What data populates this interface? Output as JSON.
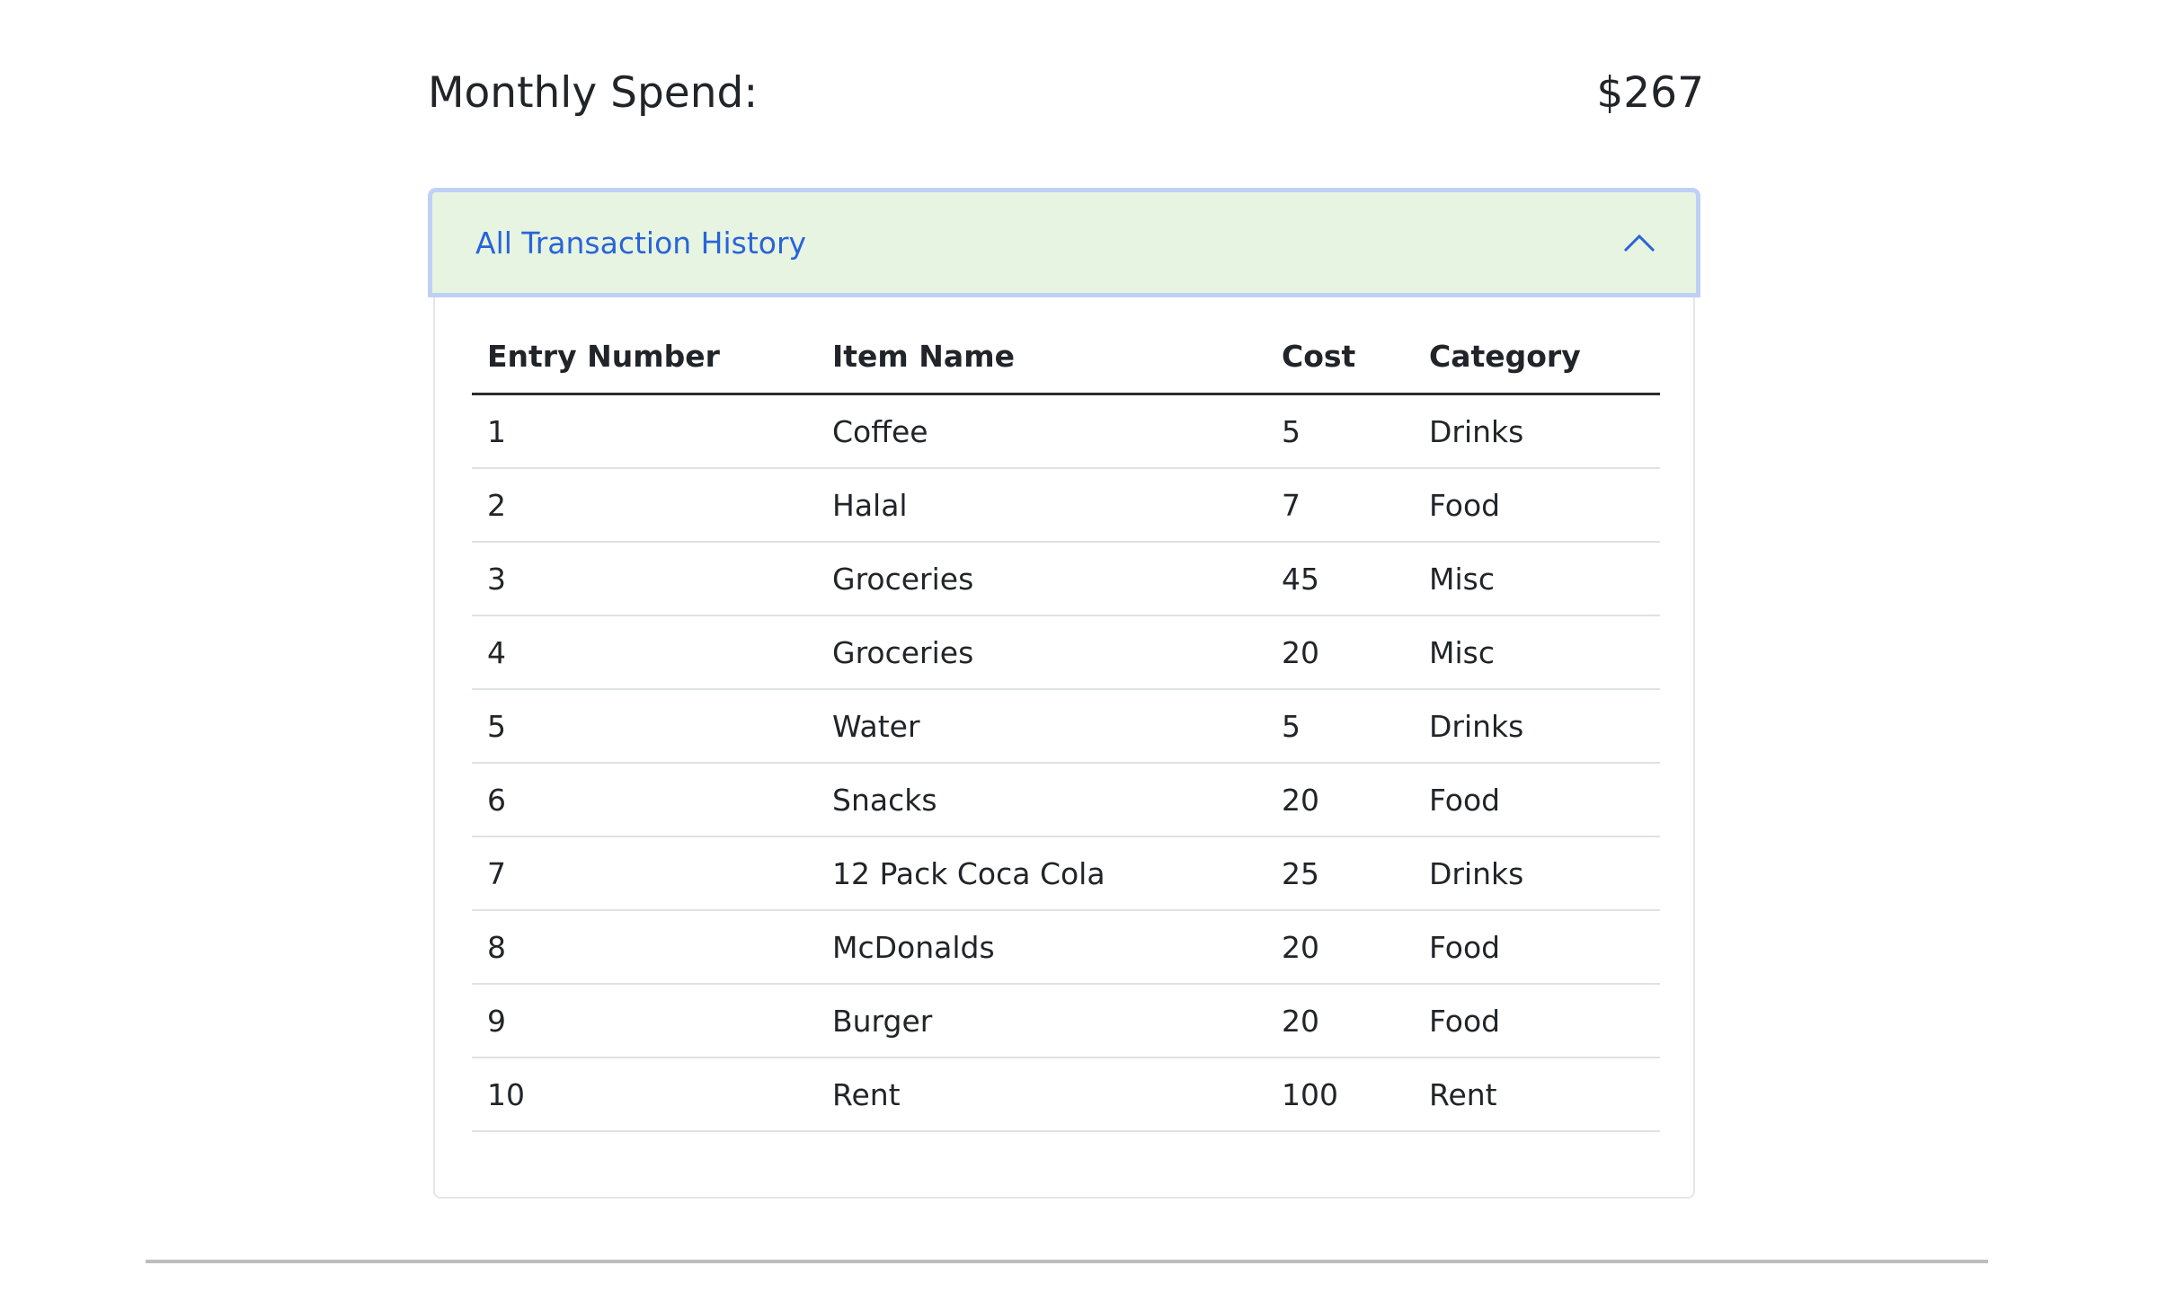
{
  "summary": {
    "label": "Monthly Spend:",
    "amount": "$267"
  },
  "accordion": {
    "title": "All Transaction History",
    "expanded": true,
    "toggle_icon": "chevron-up-icon",
    "header_background": "#e6f4e1",
    "header_border": "#bfd0f7",
    "title_color": "#2a63d8"
  },
  "table": {
    "headers": [
      "Entry Number",
      "Item Name",
      "Cost",
      "Category"
    ],
    "rows": [
      [
        "1",
        "Coffee",
        "5",
        "Drinks"
      ],
      [
        "2",
        "Halal",
        "7",
        "Food"
      ],
      [
        "3",
        "Groceries",
        "45",
        "Misc"
      ],
      [
        "4",
        "Groceries",
        "20",
        "Misc"
      ],
      [
        "5",
        "Water",
        "5",
        "Drinks"
      ],
      [
        "6",
        "Snacks",
        "20",
        "Food"
      ],
      [
        "7",
        "12 Pack Coca Cola",
        "25",
        "Drinks"
      ],
      [
        "8",
        "McDonalds",
        "20",
        "Food"
      ],
      [
        "9",
        "Burger",
        "20",
        "Food"
      ],
      [
        "10",
        "Rent",
        "100",
        "Rent"
      ]
    ]
  }
}
